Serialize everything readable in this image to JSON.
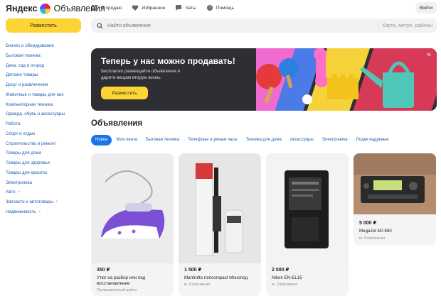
{
  "header": {
    "brand": "Яндекс",
    "product": "Объявления",
    "nav": [
      {
        "label": "Я продаю",
        "icon": "grid-icon"
      },
      {
        "label": "Избранное",
        "icon": "heart-icon"
      },
      {
        "label": "Чаты",
        "icon": "chat-bubble-icon"
      },
      {
        "label": "Помощь",
        "icon": "help-circle-icon"
      }
    ],
    "login_label": "Войти",
    "place_label": "Разместить"
  },
  "search": {
    "placeholder": "Найти объявление",
    "location_placeholder": "Карта, метро, районы"
  },
  "sidebar": {
    "categories": [
      "Бизнес и оборудование",
      "Бытовая техника",
      "Дача, сад и огород",
      "Детские товары",
      "Досуг и развлечения",
      "Животные и товары для них",
      "Компьютерная техника",
      "Одежда, обувь и аксессуары",
      "Работа",
      "Спорт и отдых",
      "Строительство и ремонт",
      "Товары для дома",
      "Товары для здоровья",
      "Товары для красоты",
      "Электроника",
      "Авто",
      "Запчасти и автотовары",
      "Недвижимость"
    ]
  },
  "banner": {
    "title": "Теперь у нас можно продавать!",
    "subtitle": "Бесплатно размещайте объявления и дарите вещам вторую жизнь",
    "button_label": "Разместить",
    "colors": {
      "background": "#2e2e35",
      "accent": "#fcd535"
    }
  },
  "listings": {
    "title": "Объявления",
    "tabs": [
      "Новое",
      "Моя лента",
      "Бытовая техника",
      "Телефоны и умные часы",
      "Техника для дома",
      "Аксессуары",
      "Электроника",
      "Подки надувные"
    ],
    "active_tab": "Новое",
    "cards": [
      {
        "price": "350 ₽",
        "name": "Утюг на разбор или под восстановление",
        "location": "Промышленный район"
      },
      {
        "price": "1 500 ₽",
        "name": "Manfrotto mmcompact Монопод",
        "location": "м. Спортивная"
      },
      {
        "price": "2 000 ₽",
        "name": "Nikon EN-EL15",
        "location": "м. Спортивная"
      },
      {
        "price": "5 000 ₽",
        "name": "MegaJet MJ 850",
        "location": "м. Спортивная"
      }
    ]
  },
  "colors": {
    "link": "#1a5fb4",
    "primary_button": "#fcd535",
    "active_tab": "#1a73e8"
  }
}
